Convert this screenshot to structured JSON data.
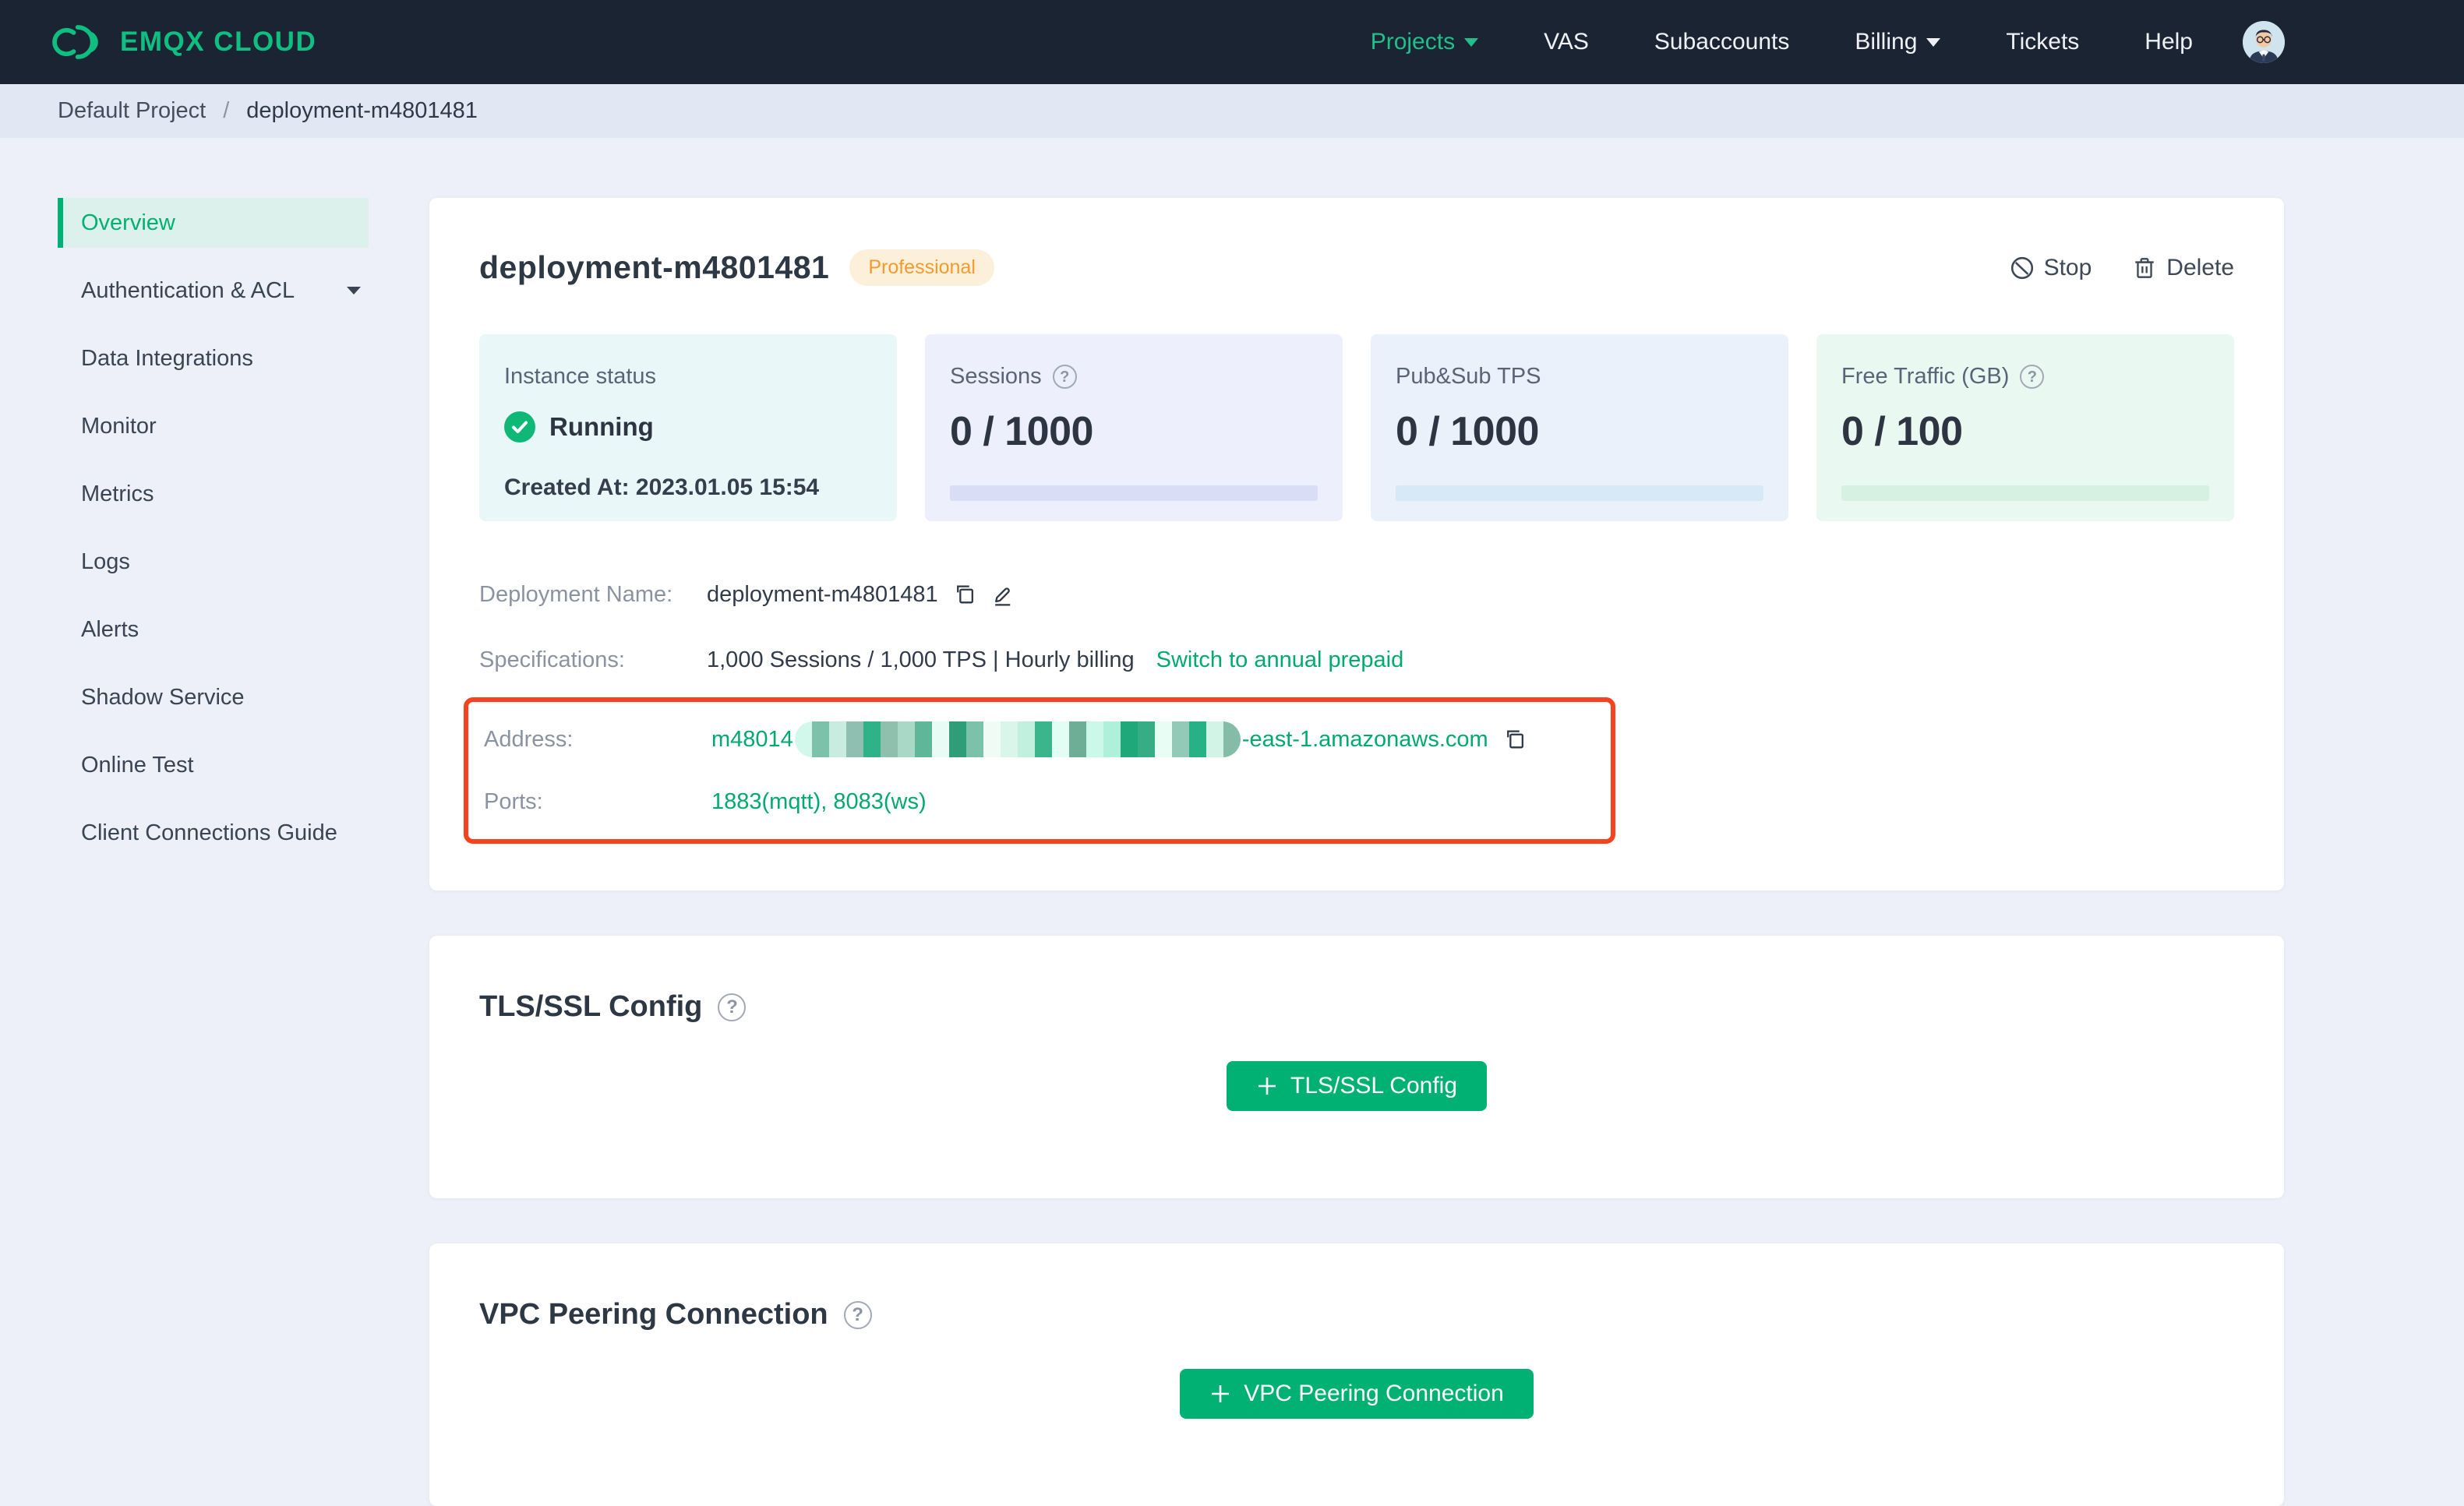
{
  "nav": {
    "brand": "EMQX CLOUD",
    "items": [
      {
        "label": "Projects",
        "caret": true,
        "active": true
      },
      {
        "label": "VAS"
      },
      {
        "label": "Subaccounts"
      },
      {
        "label": "Billing",
        "caret": true
      },
      {
        "label": "Tickets"
      },
      {
        "label": "Help"
      }
    ]
  },
  "breadcrumb": {
    "project": "Default Project",
    "separator": "/",
    "current": "deployment-m4801481"
  },
  "sidebar": {
    "items": [
      {
        "label": "Overview",
        "active": true
      },
      {
        "label": "Authentication & ACL",
        "caret": true
      },
      {
        "label": "Data Integrations"
      },
      {
        "label": "Monitor"
      },
      {
        "label": "Metrics"
      },
      {
        "label": "Logs"
      },
      {
        "label": "Alerts"
      },
      {
        "label": "Shadow Service"
      },
      {
        "label": "Online Test"
      },
      {
        "label": "Client Connections Guide"
      }
    ]
  },
  "deployment": {
    "title": "deployment-m4801481",
    "badge": "Professional",
    "actions": {
      "stop": "Stop",
      "delete": "Delete"
    },
    "stats": {
      "instance": {
        "label": "Instance status",
        "status": "Running",
        "created": "Created At: 2023.01.05 15:54"
      },
      "sessions": {
        "label": "Sessions",
        "value": "0 / 1000"
      },
      "tps": {
        "label": "Pub&Sub TPS",
        "value": "0 / 1000"
      },
      "traffic": {
        "label": "Free Traffic (GB)",
        "value": "0 / 100"
      }
    },
    "details": {
      "name_label": "Deployment Name:",
      "name_value": "deployment-m4801481",
      "spec_label": "Specifications:",
      "spec_value": "1,000 Sessions / 1,000 TPS | Hourly billing",
      "spec_link": "Switch to annual prepaid",
      "address_label": "Address:",
      "address_prefix": "m48014",
      "address_suffix": "-east-1.amazonaws.com",
      "ports_label": "Ports:",
      "ports_value": "1883(mqtt), 8083(ws)"
    },
    "mosaic_colors": [
      "#d2f8ec",
      "#7cc2ab",
      "#c8ede0",
      "#8fbfb0",
      "#2fb287",
      "#8fc0ad",
      "#a9d8c7",
      "#5fb79a",
      "#e8fcf5",
      "#2f9e78",
      "#7cc2aa",
      "#f0fbf6",
      "#d9f6ea",
      "#c2f0df",
      "#3bb68c",
      "#e2fdf4",
      "#6fae96",
      "#caf8e9",
      "#aef0d9",
      "#1fa97b",
      "#36ad84",
      "#e8fdf4",
      "#93cab7",
      "#27b285",
      "#d2f4e6",
      "#85bca7"
    ]
  },
  "tls": {
    "heading": "TLS/SSL Config",
    "button": "TLS/SSL Config"
  },
  "vpc": {
    "heading": "VPC Peering Connection",
    "button": "VPC Peering Connection"
  },
  "icons": {
    "help": "?"
  },
  "colors": {
    "brand_green": "#00b173",
    "annotation_red": "#f5431f",
    "badge_orange": "#f39b2d"
  }
}
